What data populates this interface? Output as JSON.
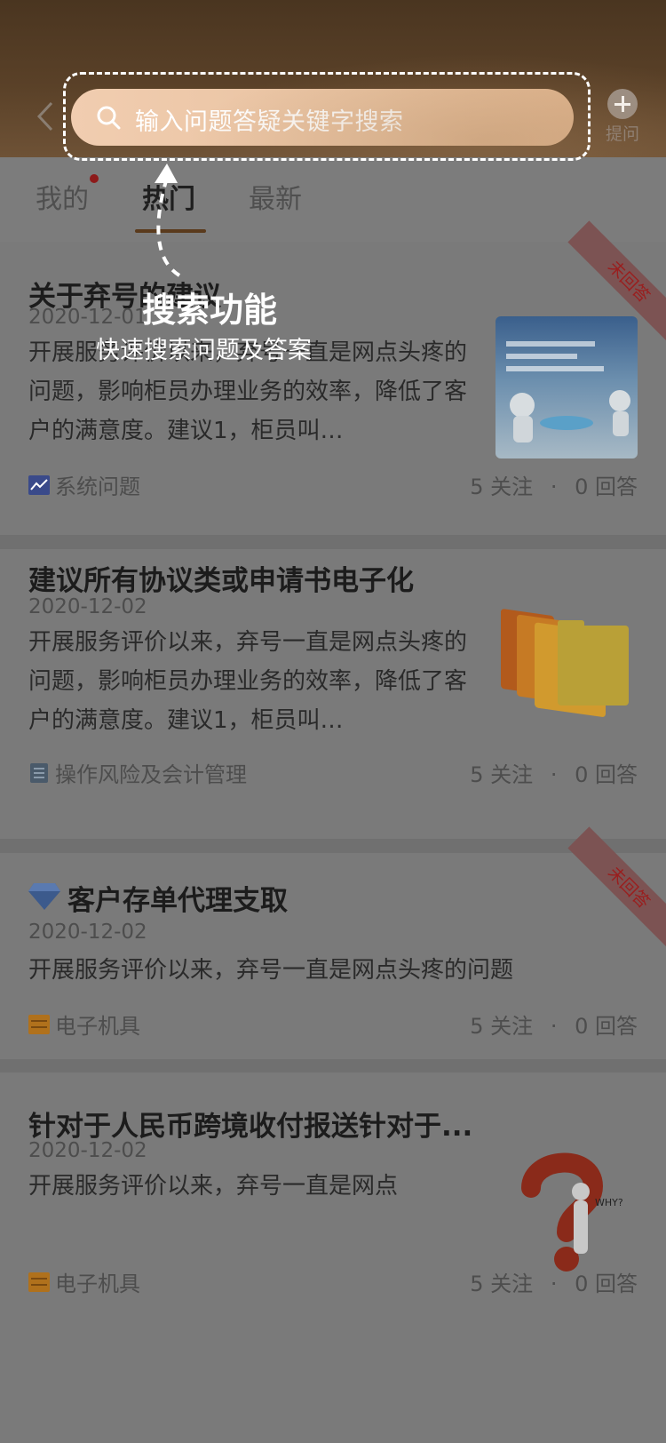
{
  "header": {
    "search_placeholder": "输入问题答疑关键字搜索",
    "ask_label": "提问"
  },
  "tabs": [
    {
      "label": "我的",
      "has_dot": true
    },
    {
      "label": "热门",
      "active": true
    },
    {
      "label": "最新"
    }
  ],
  "guide": {
    "title": "搜索功能",
    "subtitle": "快速搜索问题及答案"
  },
  "questions": [
    {
      "title": "关于弃号的建议",
      "date": "2020-12-01",
      "desc": "开展服务评价以来，弃号一直是网点头疼的问题，影响柜员办理业务的效率，降低了客户的满意度。建议1，柜员叫…",
      "category": "系统问题",
      "category_icon": "chart-icon",
      "follow": "5 关注",
      "answers": "0 回答",
      "badge": "未回答",
      "thumb": "robot-image"
    },
    {
      "title": "建议所有协议类或申请书电子化",
      "date": "2020-12-02",
      "desc": "开展服务评价以来，弃号一直是网点头疼的问题，影响柜员办理业务的效率，降低了客户的满意度。建议1，柜员叫…",
      "category": "操作风险及会计管理",
      "category_icon": "document-icon",
      "follow": "5 关注",
      "answers": "0 回答",
      "thumb": "folders-image"
    },
    {
      "title": "客户存单代理支取",
      "date": "2020-12-02",
      "desc": "开展服务评价以来，弃号一直是网点头疼的问题",
      "category": "电子机具",
      "category_icon": "machine-icon",
      "follow": "5 关注",
      "answers": "0 回答",
      "badge": "未回答",
      "title_icon": "diamond-icon"
    },
    {
      "title": "针对于人民币跨境收付报送针对于...",
      "date": "2020-12-02",
      "desc": "开展服务评价以来，弃号一直是网点",
      "category": "电子机具",
      "category_icon": "machine-icon",
      "follow": "5 关注",
      "answers": "0 回答",
      "thumb": "question-mark-image"
    }
  ],
  "stat_sep": "·",
  "colors": {
    "badge_text": "#9a1e1e",
    "search_pill": "#e8c2a0",
    "accent_underline": "#5a3a1c"
  }
}
